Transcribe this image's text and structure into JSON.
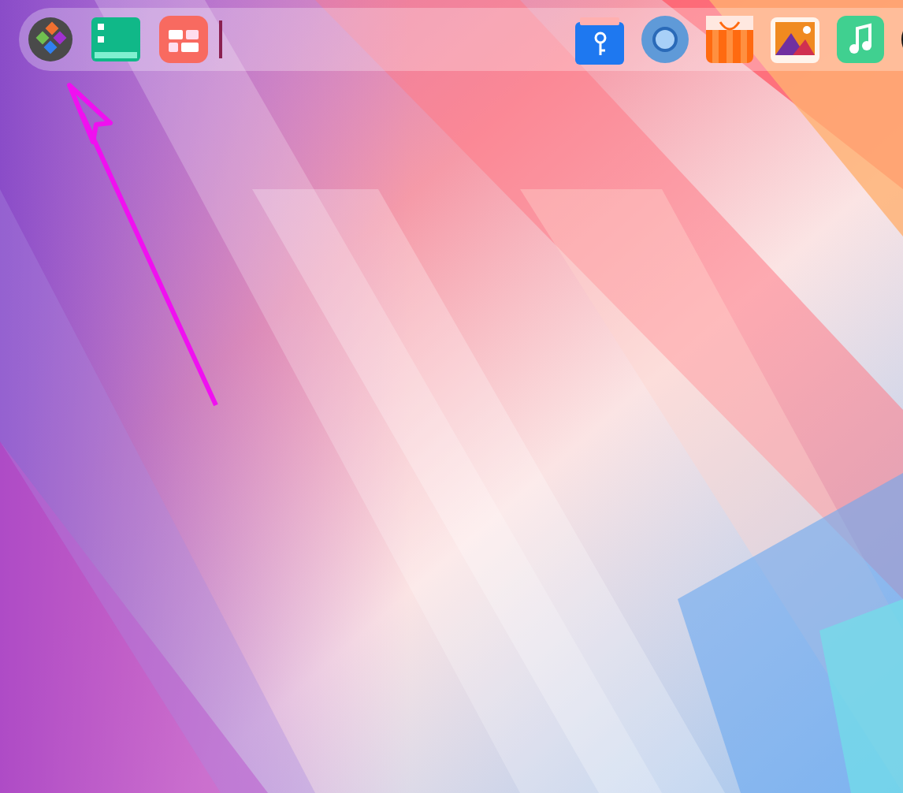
{
  "dock": {
    "left_items": [
      {
        "kind": "launcher"
      },
      {
        "kind": "sheet"
      },
      {
        "kind": "widgets"
      },
      {
        "kind": "divider"
      }
    ],
    "right_items": [
      {
        "kind": "files"
      },
      {
        "kind": "browser"
      },
      {
        "kind": "store"
      },
      {
        "kind": "photos"
      },
      {
        "kind": "music"
      },
      {
        "kind": "circle"
      }
    ]
  },
  "annotation": {
    "kind": "arrow"
  }
}
